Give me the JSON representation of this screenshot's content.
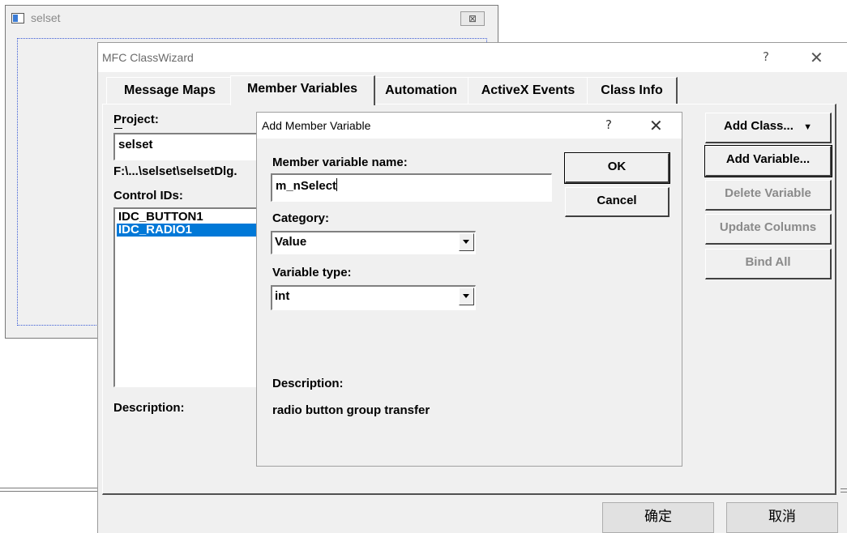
{
  "background_window": {
    "title": "selset",
    "close_glyph": "⊠"
  },
  "classwizard": {
    "title": "MFC ClassWizard",
    "help_glyph": "?",
    "close_glyph": "✕",
    "tabs": [
      {
        "label": "Message Maps"
      },
      {
        "label": "Member Variables"
      },
      {
        "label": "Automation"
      },
      {
        "label": "ActiveX Events"
      },
      {
        "label": "Class Info"
      }
    ],
    "selected_tab": "Member Variables",
    "project_label": "Project:",
    "project_value": "selset",
    "path_text": "F:\\...\\selset\\selsetDlg.",
    "control_ids_label": "Control IDs:",
    "control_ids": [
      "IDC_BUTTON1",
      "IDC_RADIO1"
    ],
    "selected_control_id": "IDC_RADIO1",
    "description_label": "Description:",
    "buttons": {
      "add_class": "Add Class...",
      "add_variable": "Add Variable...",
      "delete_variable": "Delete Variable",
      "update_columns": "Update Columns",
      "bind_all": "Bind All"
    },
    "bottom_buttons": {
      "ok": "确定",
      "cancel": "取消"
    }
  },
  "add_member_variable": {
    "title": "Add Member Variable",
    "help_glyph": "?",
    "close_glyph": "✕",
    "name_label": "Member variable name:",
    "name_value": "m_nSelect",
    "category_label": "Category:",
    "category_value": "Value",
    "type_label": "Variable type:",
    "type_value": "int",
    "description_label": "Description:",
    "description_text": "radio button group transfer",
    "ok_label": "OK",
    "cancel_label": "Cancel"
  },
  "colors": {
    "selection": "#0078d7",
    "dialog_bg": "#f0f0f0",
    "focus_dotted": "#3a5bd5"
  }
}
